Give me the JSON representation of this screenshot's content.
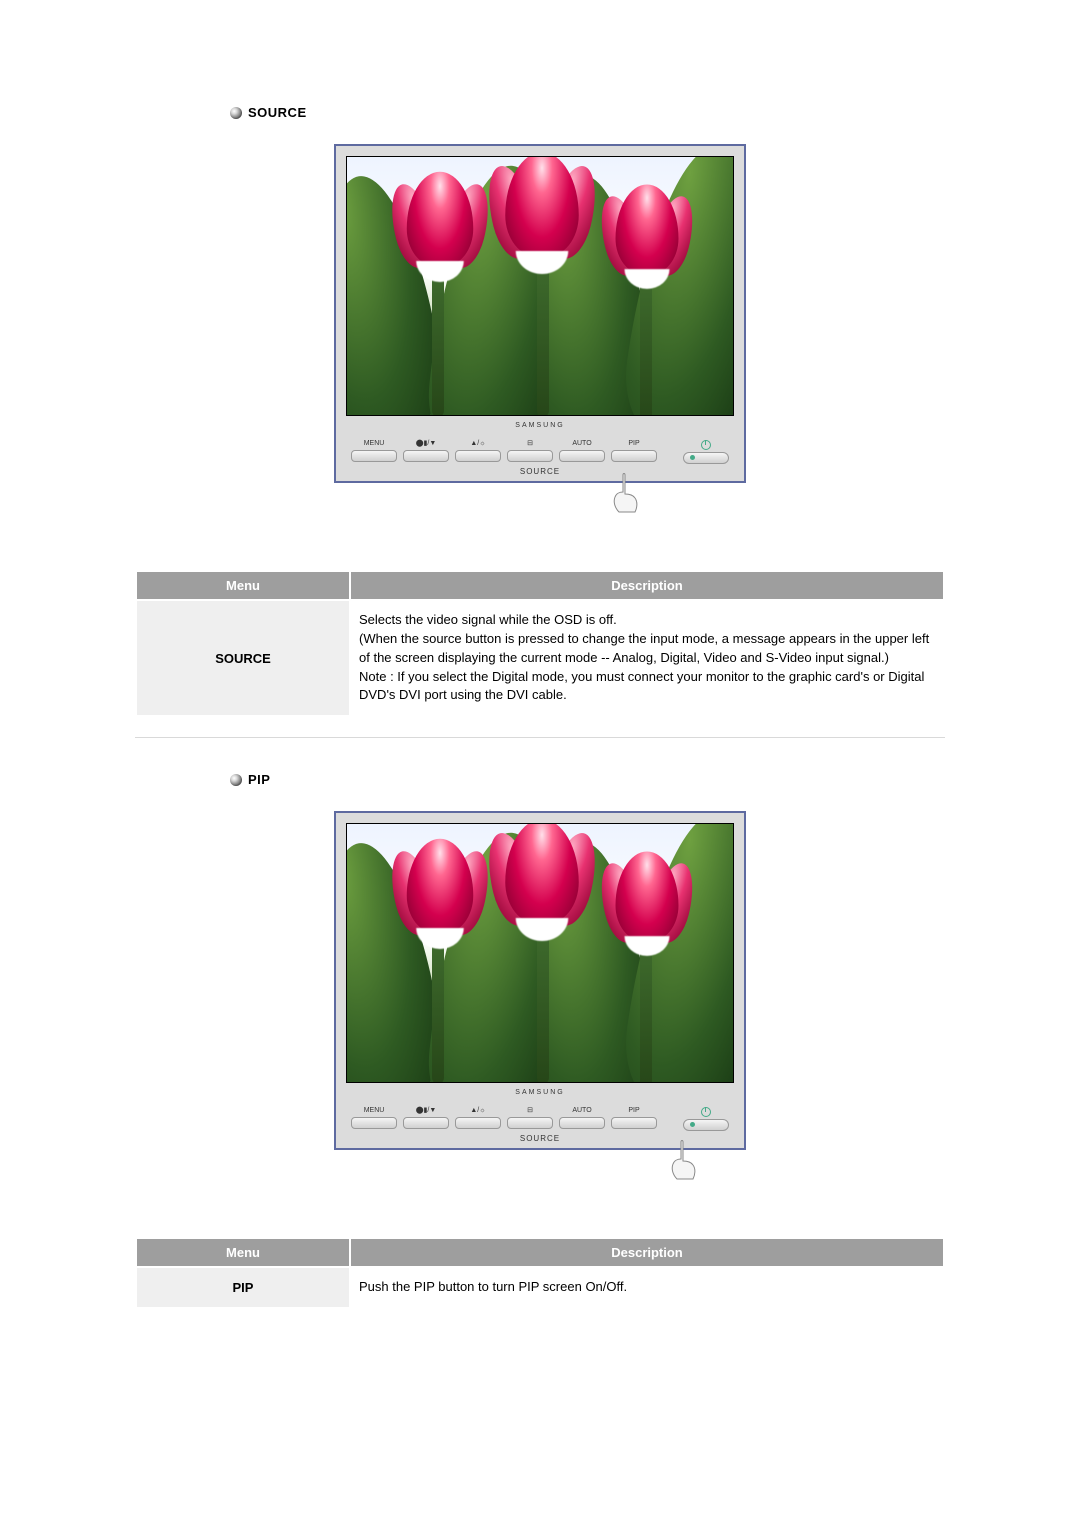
{
  "sections": {
    "source": {
      "heading": "SOURCE",
      "monitor_brand": "SAMSUNG",
      "controls": [
        "MENU",
        "⬤▮/▼",
        "▲/☼",
        "⊟",
        "AUTO",
        "PIP"
      ],
      "source_caption": "SOURCE",
      "finger_target": "SOURCE"
    },
    "pip": {
      "heading": "PIP",
      "monitor_brand": "SAMSUNG",
      "controls": [
        "MENU",
        "⬤▮/▼",
        "▲/☼",
        "⊟",
        "AUTO",
        "PIP"
      ],
      "source_caption": "SOURCE",
      "finger_target": "PIP"
    }
  },
  "table_headers": {
    "menu": "Menu",
    "description": "Description"
  },
  "tables": {
    "source": {
      "menu": "SOURCE",
      "description": "Selects the video signal while the OSD is off.\n(When the source button is pressed to change the input mode, a message appears in the upper left of the screen displaying the current mode -- Analog, Digital, Video and S-Video input signal.)\nNote : If you select the Digital mode, you must connect your monitor to the graphic card's or Digital DVD's DVI port using the DVI cable."
    },
    "pip": {
      "menu": "PIP",
      "description": "Push the PIP button to turn PIP screen On/Off."
    }
  }
}
